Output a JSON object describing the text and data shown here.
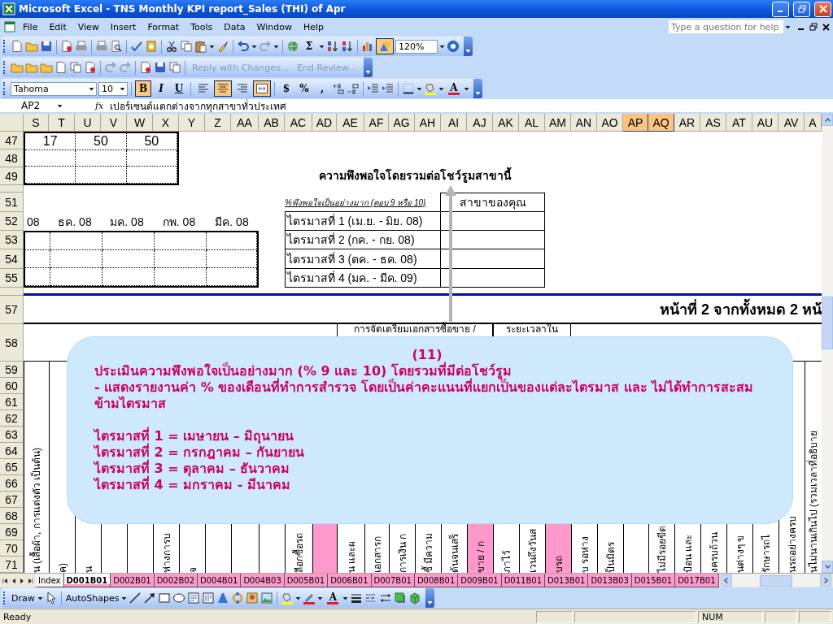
{
  "window": {
    "title": "Microsoft Excel - TNS Monthly KPI report_Sales (THI) of Apr"
  },
  "menu": {
    "items": [
      "File",
      "Edit",
      "View",
      "Insert",
      "Format",
      "Tools",
      "Data",
      "Window",
      "Help"
    ],
    "help_placeholder": "Type a question for help"
  },
  "standard_toolbar": {
    "sum": "Σ",
    "zoom": "120%",
    "drawing_active": true
  },
  "reviewing_toolbar": {
    "buttons": [
      {
        "label": "Reply with Changes...",
        "disabled": true
      },
      {
        "label": "End Review...",
        "disabled": true
      }
    ]
  },
  "formatting_toolbar": {
    "font": "Tahoma",
    "size": "10",
    "styles": [
      {
        "label": "B",
        "active": true
      },
      {
        "label": "I",
        "active": false
      },
      {
        "label": "U",
        "active": false
      }
    ],
    "alignment": [
      {
        "active": false
      },
      {
        "active": true
      },
      {
        "active": false
      },
      {
        "active": true
      }
    ],
    "number_formats": [
      "$",
      "%",
      ","
    ],
    "font_color": "A"
  },
  "formula_bar": {
    "name_box": "AP2",
    "function_label": "fx",
    "formula": "เปอร์เซนต์แตกต่างจากทุกสาขาทั่วประเทศ"
  },
  "sheet": {
    "columns": [
      {
        "label": "S",
        "selected": false
      },
      {
        "label": "T",
        "selected": false
      },
      {
        "label": "U",
        "selected": false
      },
      {
        "label": "V",
        "selected": false
      },
      {
        "label": "W",
        "selected": false
      },
      {
        "label": "X",
        "selected": false
      },
      {
        "label": "Y",
        "selected": false
      },
      {
        "label": "Z",
        "selected": false
      },
      {
        "label": "AA",
        "selected": false
      },
      {
        "label": "AB",
        "selected": false
      },
      {
        "label": "AC",
        "selected": false
      },
      {
        "label": "AD",
        "selected": false
      },
      {
        "label": "AE",
        "selected": false
      },
      {
        "label": "AF",
        "selected": false
      },
      {
        "label": "AG",
        "selected": false
      },
      {
        "label": "AH",
        "selected": false
      },
      {
        "label": "AI",
        "selected": false
      },
      {
        "label": "AJ",
        "selected": false
      },
      {
        "label": "AK",
        "selected": false
      },
      {
        "label": "AL",
        "selected": false
      },
      {
        "label": "AM",
        "selected": false
      },
      {
        "label": "AN",
        "selected": false
      },
      {
        "label": "AO",
        "selected": false
      },
      {
        "label": "AP",
        "selected": true
      },
      {
        "label": "AQ",
        "selected": true
      },
      {
        "label": "AR",
        "selected": false
      },
      {
        "label": "AS",
        "selected": false
      },
      {
        "label": "AT",
        "selected": false
      },
      {
        "label": "AU",
        "selected": false
      },
      {
        "label": "AV",
        "selected": false
      },
      {
        "label": "A",
        "selected": false
      }
    ],
    "rows": [
      "47",
      "48",
      "49",
      "51",
      "52",
      "53",
      "54",
      "55",
      "57",
      "58",
      "59",
      "60",
      "61",
      "62",
      "63",
      "64",
      "65",
      "66",
      "67",
      "68",
      "69",
      "70",
      "71"
    ],
    "top_block": [
      "17",
      "50",
      "50"
    ],
    "months": [
      "08",
      "ธค. 08",
      "มค. 08",
      "กพ. 08",
      "มีค. 08"
    ],
    "chart_title": "ความพึงพอใจโดยรวมต่อโชว์รูมสาขานี้",
    "quarter_table": {
      "caption": "%พึงพอใจเป็นอย่างมาก (ตอบ 9 หรือ 10)",
      "column_header": "สาขาของคุณ",
      "rows": [
        "ไตรมาสที่ 1 (เม.ย. - มิย. 08)",
        "ไตรมาสที่ 2 (กค. - กย. 08)",
        "ไตรมาสที่ 3 (ตค. - ธค. 08)",
        "ไตรมาสที่ 4 (มค. - มีค. 09)"
      ]
    },
    "page_label": "หน้าที่ 2 จากทั้งหมด 2 หน้",
    "section_headers": [
      "การจัดเตรียมเอกสารซื้อขาย /",
      "ระยะเวลาใน"
    ],
    "vertical_headers": [
      {
        "text": "น (เสื้อผ้า, การแต่งตัว เป็นต้น)",
        "highlighted": false
      },
      {
        "text": "ค)",
        "highlighted": false
      },
      {
        "text": "น",
        "highlighted": false
      },
      {
        "text": "ห่างการบ",
        "highlighted": false
      },
      {
        "text": "จ",
        "highlighted": false
      },
      {
        "text": "ลือกซื้อรถ",
        "highlighted": false
      },
      {
        "highlighted": true
      },
      {
        "text": "น และผ",
        "highlighted": false
      },
      {
        "text": "เอกสารก",
        "highlighted": false
      },
      {
        "text": "การเงิน ก",
        "highlighted": false
      },
      {
        "text": "ชี้ มีความ",
        "highlighted": false
      },
      {
        "text": "ด้นจนเสร็",
        "highlighted": false
      },
      {
        "text": "ขาย / ก",
        "highlighted": true
      },
      {
        "text": "ภาไว้",
        "highlighted": false
      },
      {
        "text": "เวนถึงวันส",
        "highlighted": false
      },
      {
        "text": "บรถ",
        "highlighted": true
      },
      {
        "text": "บ รอห่าง",
        "highlighted": false
      },
      {
        "text": "ป็นมิตร",
        "highlighted": false
      },
      {
        "text": "ไม่มีรอยขีด",
        "highlighted": false
      },
      {
        "text": "ป้อน และ",
        "highlighted": false
      },
      {
        "text": "งครบถ้วน",
        "highlighted": false
      },
      {
        "text": "นต่างๆ ข",
        "highlighted": false
      },
      {
        "text": "รักษารถไ",
        "highlighted": false
      },
      {
        "text": "นรถอย่างครบ",
        "highlighted": false
      },
      {
        "text": "นไม่นานเกินไป (รวมเวลาที่อธิบาย",
        "highlighted": false
      }
    ]
  },
  "callout": {
    "number": "(11)",
    "heading": "ประเมินความพึงพอใจเป็นอย่างมาก (% 9 และ 10) โดยรวมที่มีต่อโชว์รูม",
    "description": "- แสดงรายงานค่า % ของเดือนที่ทำการสำรวจ โดยเป็นค่าคะแนนที่แยกเป็นของแต่ละไตรมาส และ ไม่ได้ทำการสะสมข้ามไตรมาส",
    "quarters": [
      "ไตรมาสที่ 1 = เมษายน – มิถุนายน",
      "ไตรมาสที่ 2 = กรกฎาคม – กันยายน",
      "ไตรมาสที่ 3 = ตุลาคม – ธันวาคม",
      "ไตรมาสที่ 4 = มกราคม - มีนาคม"
    ]
  },
  "sheet_tabs": [
    {
      "label": "Index",
      "selected": false,
      "color": "#f4f3ee"
    },
    {
      "label": "D001B01",
      "selected": true,
      "color": "#ff99cc"
    },
    {
      "label": "D002B01",
      "selected": false,
      "color": "#ff99cc"
    },
    {
      "label": "D002B02",
      "selected": false,
      "color": "#ff99cc"
    },
    {
      "label": "D004B01",
      "selected": false,
      "color": "#ff99cc"
    },
    {
      "label": "D004B03",
      "selected": false,
      "color": "#ff99cc"
    },
    {
      "label": "D005B01",
      "selected": false,
      "color": "#ff99cc"
    },
    {
      "label": "D006B01",
      "selected": false,
      "color": "#ff99cc"
    },
    {
      "label": "D007B01",
      "selected": false,
      "color": "#ff99cc"
    },
    {
      "label": "D008B01",
      "selected": false,
      "color": "#ff99cc"
    },
    {
      "label": "D009B01",
      "selected": false,
      "color": "#ff99cc"
    },
    {
      "label": "D011B01",
      "selected": false,
      "color": "#ff99cc"
    },
    {
      "label": "D013B01",
      "selected": false,
      "color": "#ff99cc"
    },
    {
      "label": "D013B03",
      "selected": false,
      "color": "#ff99cc"
    },
    {
      "label": "D015B01",
      "selected": false,
      "color": "#ff99cc"
    },
    {
      "label": "D017B01",
      "selected": false,
      "color": "#ff99cc"
    }
  ],
  "draw_toolbar": {
    "draw": "Draw",
    "autoshapes": "AutoShapes",
    "font_color": "A"
  },
  "status_bar": {
    "status": "Ready",
    "indicators": [
      "NUM"
    ]
  }
}
